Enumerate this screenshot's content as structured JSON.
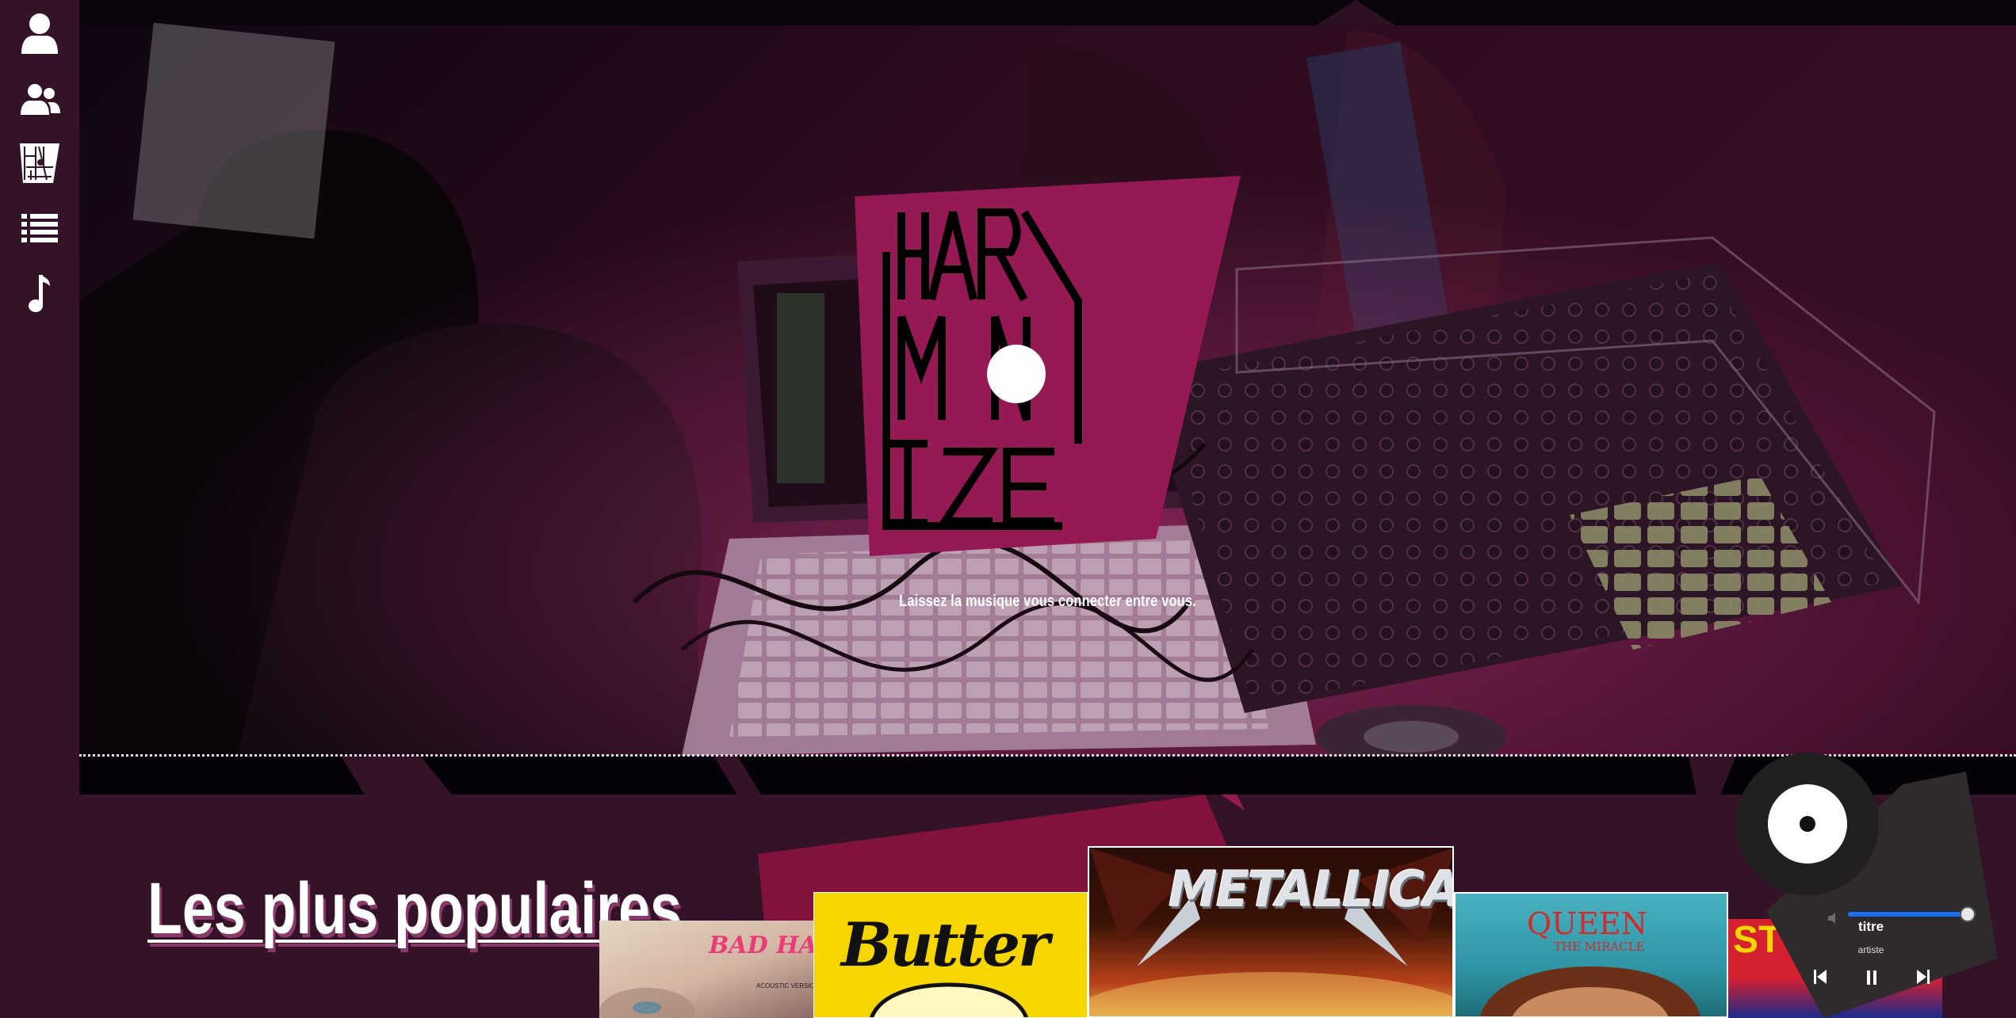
{
  "sidebar": {
    "items": [
      {
        "name": "profile",
        "icon": "user-icon"
      },
      {
        "name": "friends",
        "icon": "users-icon"
      },
      {
        "name": "home",
        "icon": "harmonize-logo-icon"
      },
      {
        "name": "playlists",
        "icon": "list-icon"
      },
      {
        "name": "music",
        "icon": "music-note-icon"
      }
    ]
  },
  "hero": {
    "logo_lines": [
      "HAR",
      "MON",
      "IZE"
    ],
    "tagline": "Laissez la musique vous connecter entre vous."
  },
  "popular": {
    "title": "Les plus populaires",
    "albums": [
      {
        "title": "BAD HABITS",
        "subtitle": "ACOUSTIC VERSION",
        "colors": [
          "#d8cdbd",
          "#e8b0a8"
        ]
      },
      {
        "title": "Butter",
        "colors": [
          "#f7d600"
        ]
      },
      {
        "title": "METALLICA",
        "colors": [
          "#2a0c08",
          "#c2401a"
        ]
      },
      {
        "title": "QUEEN",
        "subtitle": "THE MIRACLE",
        "colors": [
          "#45a9b8",
          "#1f7d8c"
        ]
      },
      {
        "title": "ST",
        "colors": [
          "#d42130"
        ]
      }
    ]
  },
  "player": {
    "title": "titre",
    "artist": "artiste",
    "progress": 1.0,
    "controls": [
      "previous-icon",
      "pause-icon",
      "next-icon"
    ],
    "volume_icon": "volume-icon"
  },
  "colors": {
    "brand_magenta": "#951a53",
    "sidebar_bg": "#341329",
    "progress_blue": "#1a6cf0"
  }
}
